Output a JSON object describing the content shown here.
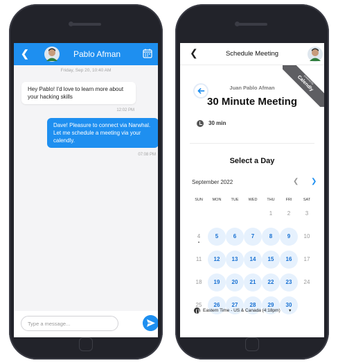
{
  "chat": {
    "contact_name": "Pablo Afman",
    "date_divider": "Friday, Sep 20, 10:40 AM",
    "messages": [
      {
        "text": "Hey Pablo! I'd love to learn more about your hacking skills",
        "time": "12:02 PM",
        "direction": "incoming"
      },
      {
        "text": "Dave! Pleasure to connect via Narwhal. Let me schedule a meeting via your calendly.",
        "time": "07:08 PM",
        "direction": "outgoing"
      }
    ],
    "input_placeholder": "Type a message...",
    "icons": {
      "back": "chevron-left-icon",
      "avatar": "avatar",
      "calendar": "calendar-icon",
      "send": "send-icon"
    },
    "colors": {
      "accent": "#1e8ff0",
      "background": "#f4f4f6"
    }
  },
  "schedule": {
    "title": "Schedule Meeting",
    "host_name": "Juan Pablo Afman",
    "event_name": "30 Minute Meeting",
    "duration": "30 min",
    "badge_small": "powered by",
    "badge_big": "Calendly",
    "select_day_label": "Select a Day",
    "month_label": "September 2022",
    "weekdays": [
      "SUN",
      "MON",
      "TUE",
      "WED",
      "THU",
      "FRI",
      "SAT"
    ],
    "weeks": [
      [
        null,
        null,
        null,
        null,
        {
          "d": "1",
          "available": false
        },
        {
          "d": "2",
          "available": false
        },
        {
          "d": "3",
          "available": false
        }
      ],
      [
        {
          "d": "4",
          "available": false,
          "today": true
        },
        {
          "d": "5",
          "available": true
        },
        {
          "d": "6",
          "available": true
        },
        {
          "d": "7",
          "available": true
        },
        {
          "d": "8",
          "available": true
        },
        {
          "d": "9",
          "available": true
        },
        {
          "d": "10",
          "available": false
        }
      ],
      [
        {
          "d": "11",
          "available": false
        },
        {
          "d": "12",
          "available": true
        },
        {
          "d": "13",
          "available": true
        },
        {
          "d": "14",
          "available": true
        },
        {
          "d": "15",
          "available": true
        },
        {
          "d": "16",
          "available": true
        },
        {
          "d": "17",
          "available": false
        }
      ],
      [
        {
          "d": "18",
          "available": false
        },
        {
          "d": "19",
          "available": true
        },
        {
          "d": "20",
          "available": true
        },
        {
          "d": "21",
          "available": true
        },
        {
          "d": "22",
          "available": true
        },
        {
          "d": "23",
          "available": true
        },
        {
          "d": "24",
          "available": false
        }
      ],
      [
        {
          "d": "25",
          "available": false
        },
        {
          "d": "26",
          "available": true
        },
        {
          "d": "27",
          "available": true
        },
        {
          "d": "28",
          "available": true
        },
        {
          "d": "29",
          "available": true
        },
        {
          "d": "30",
          "available": true
        },
        null
      ]
    ],
    "timezone_label": "Eastern Time - US & Canada (4:18pm)",
    "icons": {
      "back": "chevron-left-icon",
      "back_arrow": "arrow-left-icon",
      "clock": "clock-icon",
      "globe": "globe-icon",
      "prev": "chevron-left-icon",
      "next": "chevron-right-icon"
    },
    "colors": {
      "accent": "#1e8ff0",
      "available_bg": "#e6f1fd",
      "badge": "#5e5e62"
    }
  }
}
